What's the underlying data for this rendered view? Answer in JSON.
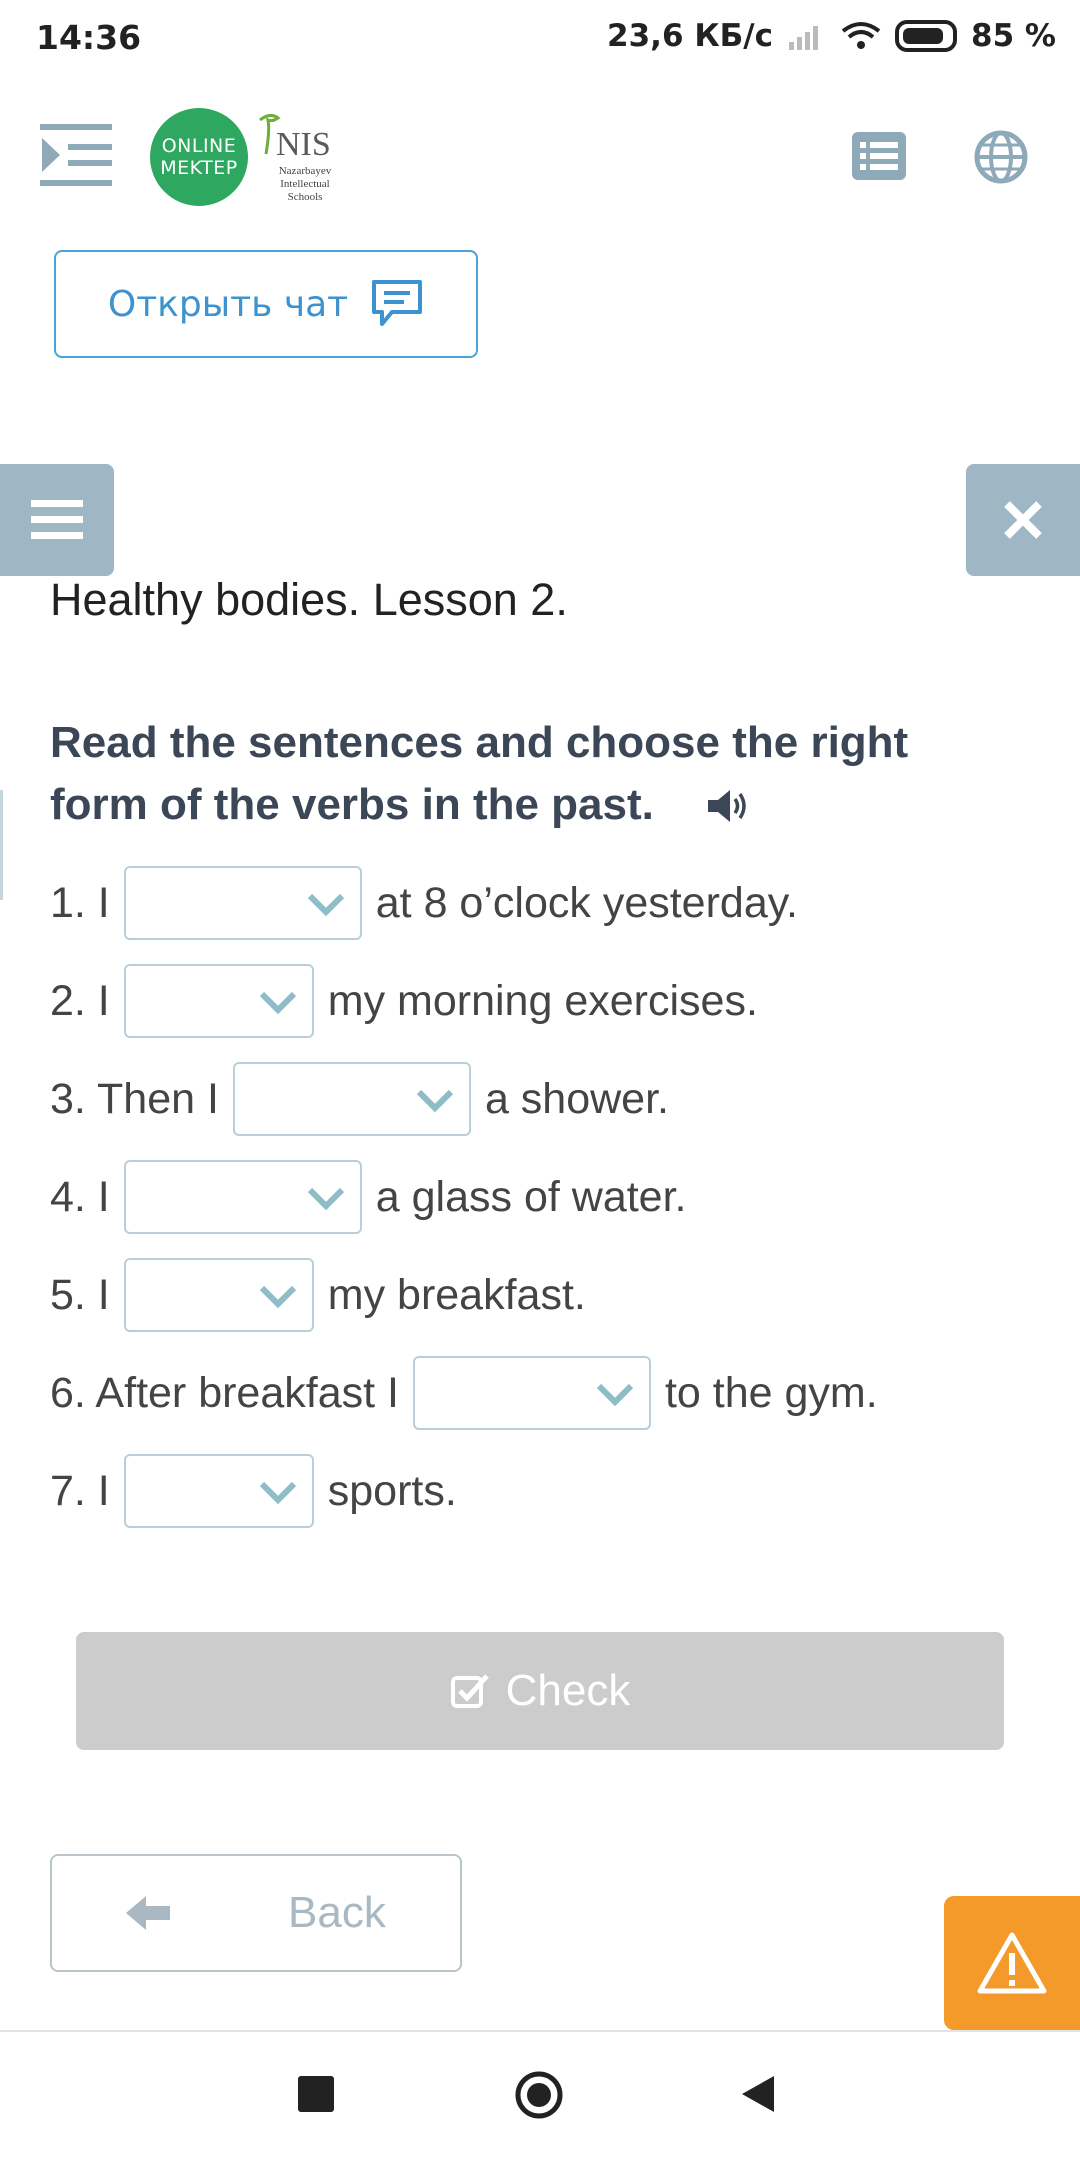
{
  "status_bar": {
    "time": "14:36",
    "network_speed": "23,6 КБ/с",
    "battery": "85 %"
  },
  "header": {
    "logo_line1": "ONLINE",
    "logo_line2": "MEKTEP",
    "partner_name": "NIS",
    "partner_sub1": "Nazarbayev",
    "partner_sub2": "Intellectual",
    "partner_sub3": "Schools"
  },
  "chat": {
    "label": "Открыть чат"
  },
  "lesson": {
    "title": "Healthy bodies. Lesson 2.",
    "instruction": "Read the sentences and choose the right form of the verbs in the past."
  },
  "exercise": {
    "items": [
      {
        "before": "1. I",
        "selected": "",
        "after": "at 8 o’clock yesterday."
      },
      {
        "before": "2. I",
        "selected": "",
        "after": "my morning exercises."
      },
      {
        "before": "3. Then I",
        "selected": "",
        "after": "a shower."
      },
      {
        "before": "4. I",
        "selected": "",
        "after": "a glass of water."
      },
      {
        "before": "5. I",
        "selected": "",
        "after": "my breakfast."
      },
      {
        "before": "6. After breakfast I",
        "selected": "",
        "after": "to the gym."
      },
      {
        "before": "7. I",
        "selected": "",
        "after": "sports."
      }
    ]
  },
  "actions": {
    "check_label": "Check",
    "back_label": "Back"
  },
  "colors": {
    "accent_blue": "#3c93cf",
    "side_tab": "#9fb7c4",
    "logo_green": "#2ea860",
    "warning": "#f39a2b",
    "disabled": "#cccccc"
  },
  "icons": [
    "menu-collapse-icon",
    "list-icon",
    "globe-icon",
    "chat-icon",
    "hamburger-icon",
    "close-icon",
    "speaker-icon",
    "chevron-down-icon",
    "checkbox-icon",
    "arrow-left-icon",
    "warning-icon",
    "stop-icon",
    "home-icon",
    "back-triangle-icon"
  ]
}
